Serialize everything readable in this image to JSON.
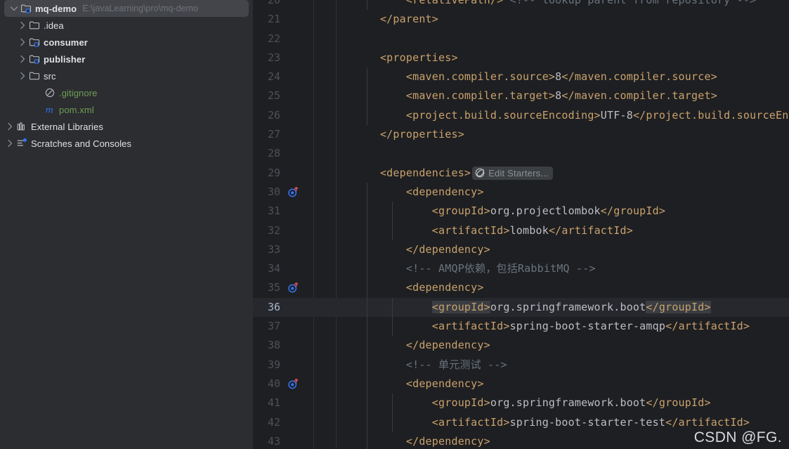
{
  "theme": {
    "sidebar_bg": "#2b2d30",
    "editor_bg": "#1e1f22",
    "selection_bg": "#43454a",
    "current_line_bg": "#26282e",
    "tag_color": "#c9a26d",
    "text_color": "#bcbec4",
    "comment_color": "#6a737d",
    "vcs_green": "#6f9e54",
    "gutter_number_color": "#4e5157"
  },
  "sidebar": {
    "name": "project-tool-window",
    "items": [
      {
        "label": "mq-demo",
        "path": "E:\\javaLearning\\pro\\mq-demo",
        "icon": "module-folder-icon",
        "arrow": "chevron-down-icon",
        "indent": 0,
        "bold": true,
        "selected": true,
        "color": "default"
      },
      {
        "label": ".idea",
        "path": "",
        "icon": "folder-icon",
        "arrow": "chevron-right-icon",
        "indent": 1,
        "bold": false,
        "selected": false,
        "color": "default"
      },
      {
        "label": "consumer",
        "path": "",
        "icon": "module-folder-icon",
        "arrow": "chevron-right-icon",
        "indent": 1,
        "bold": true,
        "selected": false,
        "color": "default"
      },
      {
        "label": "publisher",
        "path": "",
        "icon": "module-folder-icon",
        "arrow": "chevron-right-icon",
        "indent": 1,
        "bold": true,
        "selected": false,
        "color": "default"
      },
      {
        "label": "src",
        "path": "",
        "icon": "folder-icon",
        "arrow": "chevron-right-icon",
        "indent": 1,
        "bold": false,
        "selected": false,
        "color": "default"
      },
      {
        "label": ".gitignore",
        "path": "",
        "icon": "gitignore-icon",
        "arrow": "none",
        "indent": 2,
        "bold": false,
        "selected": false,
        "color": "green"
      },
      {
        "label": "pom.xml",
        "path": "",
        "icon": "maven-pom-icon",
        "arrow": "none",
        "indent": 2,
        "bold": false,
        "selected": false,
        "color": "green"
      },
      {
        "label": "External Libraries",
        "path": "",
        "icon": "library-icon",
        "arrow": "chevron-right-icon",
        "indent": 0,
        "bold": false,
        "selected": false,
        "color": "default"
      },
      {
        "label": "Scratches and Consoles",
        "path": "",
        "icon": "scratches-icon",
        "arrow": "chevron-right-icon",
        "indent": 0,
        "bold": false,
        "selected": false,
        "color": "default"
      }
    ]
  },
  "editor": {
    "name": "pom-xml-editor",
    "file": "pom.xml",
    "current_line": 36,
    "first_visible_line": 20,
    "inline_hint": {
      "label": "Edit Starters...",
      "icon": "spring-leaf-icon"
    },
    "lines": [
      {
        "num": 20,
        "gutter": "none",
        "indent_guides": 1,
        "clipped_top": true,
        "segments": [
          {
            "t": "        ",
            "c": "txt"
          },
          {
            "t": "<relativePath/>",
            "c": "tag"
          },
          {
            "t": " ",
            "c": "txt"
          },
          {
            "t": "<!-- lookup parent from repository -->",
            "c": "cmt"
          }
        ]
      },
      {
        "num": 21,
        "gutter": "none",
        "indent_guides": 0,
        "segments": [
          {
            "t": "    ",
            "c": "txt"
          },
          {
            "t": "</parent>",
            "c": "tag"
          }
        ]
      },
      {
        "num": 22,
        "gutter": "none",
        "indent_guides": 0,
        "segments": []
      },
      {
        "num": 23,
        "gutter": "none",
        "indent_guides": 0,
        "segments": [
          {
            "t": "    ",
            "c": "txt"
          },
          {
            "t": "<properties>",
            "c": "tag"
          }
        ]
      },
      {
        "num": 24,
        "gutter": "none",
        "indent_guides": 1,
        "segments": [
          {
            "t": "        ",
            "c": "txt"
          },
          {
            "t": "<maven.compiler.source>",
            "c": "tag"
          },
          {
            "t": "8",
            "c": "txt"
          },
          {
            "t": "</maven.compiler.source>",
            "c": "tag"
          }
        ]
      },
      {
        "num": 25,
        "gutter": "none",
        "indent_guides": 1,
        "segments": [
          {
            "t": "        ",
            "c": "txt"
          },
          {
            "t": "<maven.compiler.target>",
            "c": "tag"
          },
          {
            "t": "8",
            "c": "txt"
          },
          {
            "t": "</maven.compiler.target>",
            "c": "tag"
          }
        ]
      },
      {
        "num": 26,
        "gutter": "none",
        "indent_guides": 1,
        "segments": [
          {
            "t": "        ",
            "c": "txt"
          },
          {
            "t": "<project.build.sourceEncoding>",
            "c": "tag"
          },
          {
            "t": "UTF-8",
            "c": "txt"
          },
          {
            "t": "</project.build.sourceEncoding>",
            "c": "tag"
          }
        ]
      },
      {
        "num": 27,
        "gutter": "none",
        "indent_guides": 0,
        "segments": [
          {
            "t": "    ",
            "c": "txt"
          },
          {
            "t": "</properties>",
            "c": "tag"
          }
        ]
      },
      {
        "num": 28,
        "gutter": "none",
        "indent_guides": 0,
        "segments": []
      },
      {
        "num": 29,
        "gutter": "none",
        "indent_guides": 0,
        "hint_after": true,
        "segments": [
          {
            "t": "    ",
            "c": "txt"
          },
          {
            "t": "<dependencies>",
            "c": "tag"
          }
        ]
      },
      {
        "num": 30,
        "gutter": "dependency-nav-icon",
        "indent_guides": 1,
        "segments": [
          {
            "t": "        ",
            "c": "txt"
          },
          {
            "t": "<dependency>",
            "c": "tag"
          }
        ]
      },
      {
        "num": 31,
        "gutter": "none",
        "indent_guides": 2,
        "segments": [
          {
            "t": "            ",
            "c": "txt"
          },
          {
            "t": "<groupId>",
            "c": "tag"
          },
          {
            "t": "org.projectlombok",
            "c": "txt"
          },
          {
            "t": "</groupId>",
            "c": "tag"
          }
        ]
      },
      {
        "num": 32,
        "gutter": "none",
        "indent_guides": 2,
        "segments": [
          {
            "t": "            ",
            "c": "txt"
          },
          {
            "t": "<artifactId>",
            "c": "tag"
          },
          {
            "t": "lombok",
            "c": "txt"
          },
          {
            "t": "</artifactId>",
            "c": "tag"
          }
        ]
      },
      {
        "num": 33,
        "gutter": "none",
        "indent_guides": 1,
        "segments": [
          {
            "t": "        ",
            "c": "txt"
          },
          {
            "t": "</dependency>",
            "c": "tag"
          }
        ]
      },
      {
        "num": 34,
        "gutter": "none",
        "indent_guides": 1,
        "segments": [
          {
            "t": "        ",
            "c": "txt"
          },
          {
            "t": "<!-- AMQP依赖，包括RabbitMQ -->",
            "c": "cmt"
          }
        ]
      },
      {
        "num": 35,
        "gutter": "dependency-nav-icon",
        "indent_guides": 1,
        "segments": [
          {
            "t": "        ",
            "c": "txt"
          },
          {
            "t": "<dependency>",
            "c": "tag"
          }
        ]
      },
      {
        "num": 36,
        "gutter": "none",
        "indent_guides": 2,
        "current": true,
        "segments": [
          {
            "t": "            ",
            "c": "txt"
          },
          {
            "t": "<groupId>",
            "c": "tag hl"
          },
          {
            "t": "org.springframework.boot",
            "c": "txt"
          },
          {
            "t": "</groupId>",
            "c": "tag hl"
          }
        ]
      },
      {
        "num": 37,
        "gutter": "none",
        "indent_guides": 2,
        "segments": [
          {
            "t": "            ",
            "c": "txt"
          },
          {
            "t": "<artifactId>",
            "c": "tag"
          },
          {
            "t": "spring-boot-starter-amqp",
            "c": "txt"
          },
          {
            "t": "</artifactId>",
            "c": "tag"
          }
        ]
      },
      {
        "num": 38,
        "gutter": "none",
        "indent_guides": 1,
        "segments": [
          {
            "t": "        ",
            "c": "txt"
          },
          {
            "t": "</dependency>",
            "c": "tag"
          }
        ]
      },
      {
        "num": 39,
        "gutter": "none",
        "indent_guides": 1,
        "segments": [
          {
            "t": "        ",
            "c": "txt"
          },
          {
            "t": "<!-- 单元测试 -->",
            "c": "cmt"
          }
        ]
      },
      {
        "num": 40,
        "gutter": "dependency-nav-icon",
        "indent_guides": 1,
        "segments": [
          {
            "t": "        ",
            "c": "txt"
          },
          {
            "t": "<dependency>",
            "c": "tag"
          }
        ]
      },
      {
        "num": 41,
        "gutter": "none",
        "indent_guides": 2,
        "segments": [
          {
            "t": "            ",
            "c": "txt"
          },
          {
            "t": "<groupId>",
            "c": "tag"
          },
          {
            "t": "org.springframework.boot",
            "c": "txt"
          },
          {
            "t": "</groupId>",
            "c": "tag"
          }
        ]
      },
      {
        "num": 42,
        "gutter": "none",
        "indent_guides": 2,
        "segments": [
          {
            "t": "            ",
            "c": "txt"
          },
          {
            "t": "<artifactId>",
            "c": "tag"
          },
          {
            "t": "spring-boot-starter-test",
            "c": "txt"
          },
          {
            "t": "</artifactId>",
            "c": "tag"
          }
        ]
      },
      {
        "num": 43,
        "gutter": "none",
        "indent_guides": 1,
        "segments": [
          {
            "t": "        ",
            "c": "txt"
          },
          {
            "t": "</dependency>",
            "c": "tag"
          }
        ]
      }
    ]
  },
  "watermark": {
    "text": "CSDN @FG."
  }
}
